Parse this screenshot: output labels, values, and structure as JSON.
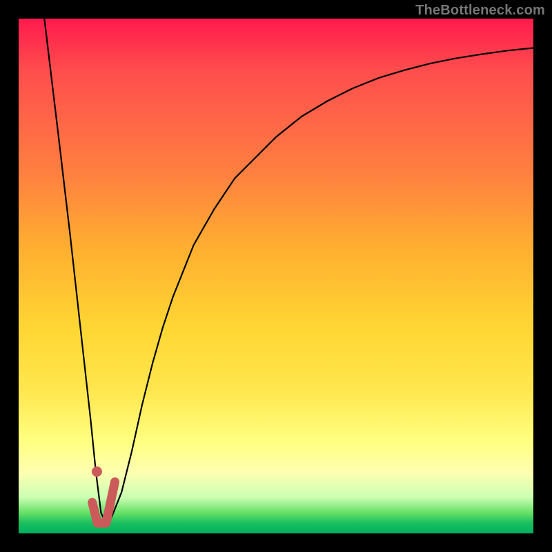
{
  "watermark": "TheBottleneck.com",
  "colors": {
    "background": "#000000",
    "curve_stroke": "#000000",
    "marker_stroke": "#cc5a5a",
    "marker_fill": "#cc5a5a"
  },
  "chart_data": {
    "type": "line",
    "title": "",
    "xlabel": "",
    "ylabel": "",
    "xlim": [
      0,
      100
    ],
    "ylim": [
      0,
      100
    ],
    "grid": false,
    "legend": false,
    "series": [
      {
        "name": "bottleneck-curve",
        "x": [
          5,
          8,
          10,
          12,
          14,
          15,
          16,
          17,
          18,
          20,
          22,
          24,
          26,
          28,
          30,
          34,
          38,
          42,
          46,
          50,
          55,
          60,
          65,
          70,
          75,
          80,
          85,
          90,
          95,
          100
        ],
        "values": [
          100,
          75,
          58,
          40,
          22,
          12,
          4,
          2,
          3,
          8,
          16,
          25,
          33,
          40,
          46,
          56,
          63,
          69,
          73,
          77,
          81,
          84,
          86.5,
          88.5,
          90,
          91.3,
          92.3,
          93.1,
          93.8,
          94.3
        ]
      }
    ],
    "marker": {
      "name": "selected-point",
      "x": 15.2,
      "y": 12,
      "hook_path": [
        {
          "x": 14.3,
          "y": 6
        },
        {
          "x": 15.3,
          "y": 2
        },
        {
          "x": 17.0,
          "y": 2
        },
        {
          "x": 18.7,
          "y": 10
        }
      ]
    }
  }
}
